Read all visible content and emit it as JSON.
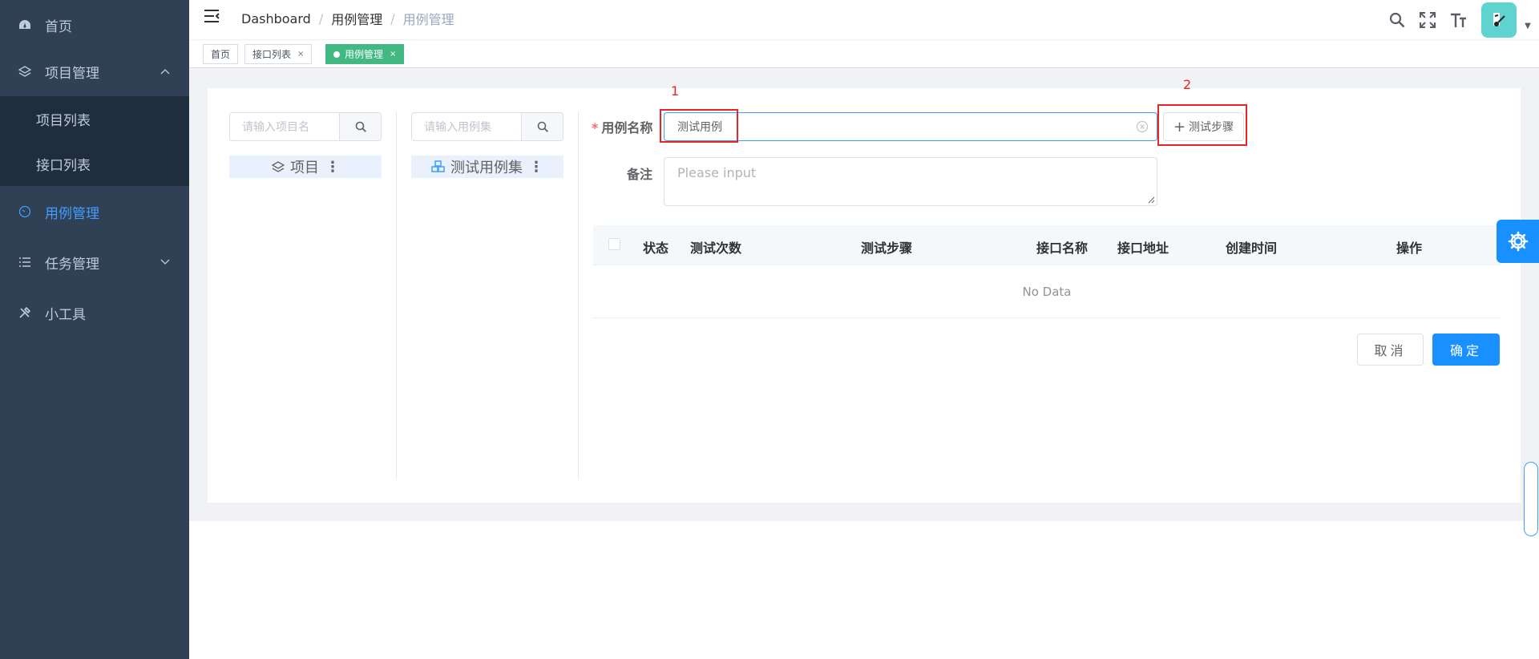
{
  "sidebar": {
    "items": [
      {
        "label": "首页",
        "icon": "dashboard-icon"
      },
      {
        "label": "项目管理",
        "icon": "layers-icon",
        "expanded": true
      },
      {
        "label": "项目列表"
      },
      {
        "label": "接口列表"
      },
      {
        "label": "用例管理",
        "icon": "gauge-icon",
        "active": true
      },
      {
        "label": "任务管理",
        "icon": "list-icon"
      },
      {
        "label": "小工具",
        "icon": "tools-icon"
      }
    ]
  },
  "header": {
    "breadcrumb": [
      "Dashboard",
      "用例管理",
      "用例管理"
    ],
    "separator": "/"
  },
  "tags": [
    {
      "label": "首页"
    },
    {
      "label": "接口列表",
      "close": "×"
    },
    {
      "label": "用例管理",
      "close": "×",
      "active": true
    }
  ],
  "left_panel": {
    "project_search_placeholder": "请输入项目名",
    "project_node": "项目",
    "caseset_search_placeholder": "请输入用例集",
    "caseset_node": "测试用例集",
    "kebab": "⋮"
  },
  "form": {
    "required_mark": "*",
    "name_label": "用例名称",
    "name_value": "测试用例",
    "steps_button": "测试步骤",
    "remark_label": "备注",
    "remark_placeholder": "Please input"
  },
  "annotations": {
    "first": "1",
    "second": "2"
  },
  "table": {
    "columns": [
      "状态",
      "测试次数",
      "测试步骤",
      "接口名称",
      "接口地址",
      "创建时间",
      "操作"
    ],
    "empty_text": "No Data"
  },
  "buttons": {
    "cancel": "取消",
    "confirm": "确定"
  },
  "colors": {
    "sidebar": "#304156",
    "primary": "#1890ff",
    "tag_active": "#42b983",
    "annotation": "#e42626"
  }
}
